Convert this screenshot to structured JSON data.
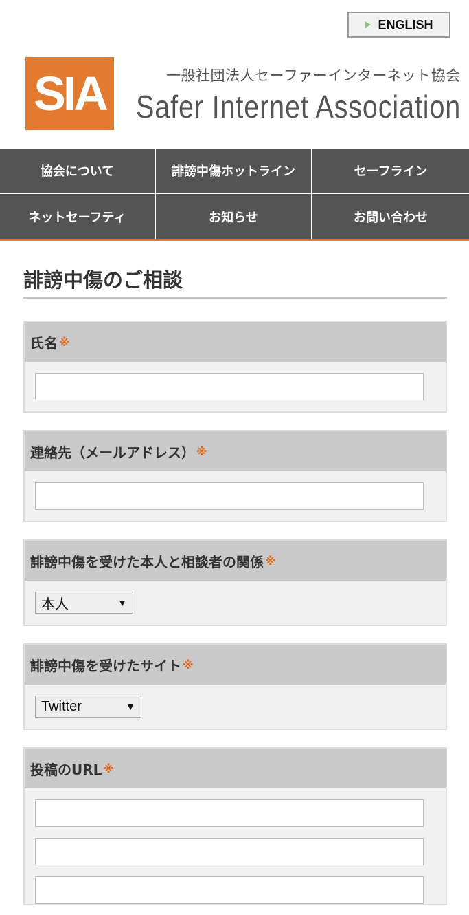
{
  "header": {
    "lang_button": "ENGLISH",
    "logo_text": "SIA",
    "org_name_jp": "一般社団法人セーファーインターネット協会",
    "org_name_en": "Safer Internet Association"
  },
  "nav": {
    "items": [
      "協会について",
      "誹謗中傷ホットライン",
      "セーフライン",
      "ネットセーフティ",
      "お知らせ",
      "お問い合わせ"
    ]
  },
  "page": {
    "title": "誹謗中傷のご相談"
  },
  "form": {
    "required_mark": "※",
    "name_label": "氏名",
    "email_label": "連絡先（メールアドレス）",
    "relation_label": "誹謗中傷を受けた本人と相談者の関係",
    "relation_value": "本人",
    "site_label": "誹謗中傷を受けたサイト",
    "site_value": "Twitter",
    "url_label": "投稿のURL"
  },
  "colors": {
    "accent": "#e27b2f",
    "nav_bg": "#545454",
    "label_bg": "#cacaca",
    "required": "#e06a1e"
  }
}
